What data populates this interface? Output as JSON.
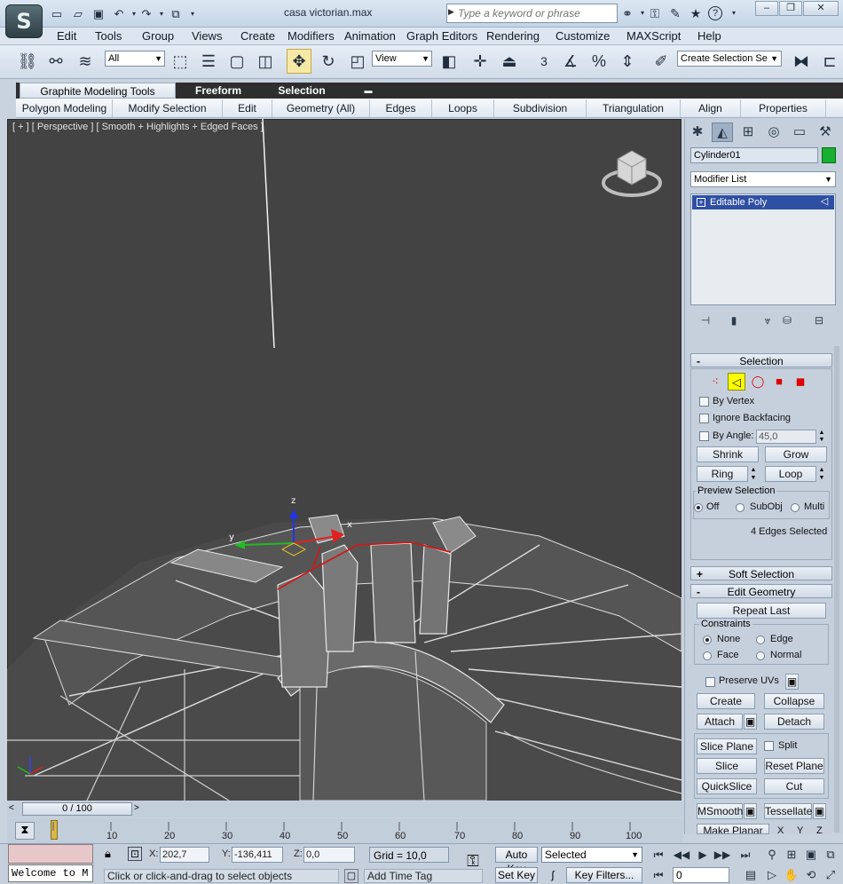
{
  "titlebar": {
    "doc_title": "casa victorian.max",
    "search_placeholder": "Type a keyword or phrase",
    "logo_glyph": "S"
  },
  "menu": [
    "Edit",
    "Tools",
    "Group",
    "Views",
    "Create",
    "Modifiers",
    "Animation",
    "Graph Editors",
    "Rendering",
    "Customize",
    "MAXScript",
    "Help"
  ],
  "toolbar": {
    "selection_filter": "All",
    "reference_coord": "View",
    "angle_snap_label": "3",
    "selection_set_placeholder": "Create Selection Se"
  },
  "ribbon": {
    "tabs": [
      "Graphite Modeling Tools",
      "Freeform",
      "Selection"
    ],
    "panels": [
      "Polygon Modeling",
      "Modify Selection",
      "Edit",
      "Geometry (All)",
      "Edges",
      "Loops",
      "Subdivision",
      "Triangulation",
      "Align",
      "Properties"
    ]
  },
  "viewport": {
    "label": "[ + ] [ Perspective ] [ Smooth + Highlights + Edged Faces ]",
    "gizmo_axes": {
      "x": "x",
      "y": "y",
      "z": "z"
    }
  },
  "command_panel": {
    "object_name": "Cylinder01",
    "object_color": "#17b030",
    "modifier_list": "Modifier List",
    "stack_item": "Editable Poly",
    "selection": {
      "title": "Selection",
      "by_vertex": "By Vertex",
      "ignore_backfacing": "Ignore Backfacing",
      "by_angle": "By Angle:",
      "by_angle_value": "45,0",
      "shrink": "Shrink",
      "grow": "Grow",
      "ring": "Ring",
      "loop": "Loop",
      "preview_selection": "Preview Selection",
      "preview_options": [
        "Off",
        "SubObj",
        "Multi"
      ],
      "status": "4 Edges Selected"
    },
    "soft_selection": "Soft Selection",
    "edit_geometry": {
      "title": "Edit Geometry",
      "repeat_last": "Repeat Last",
      "constraints": "Constraints",
      "constraint_options": [
        "None",
        "Edge",
        "Face",
        "Normal"
      ],
      "preserve_uvs": "Preserve UVs",
      "create": "Create",
      "collapse": "Collapse",
      "attach": "Attach",
      "detach": "Detach",
      "slice_plane": "Slice Plane",
      "split": "Split",
      "slice": "Slice",
      "reset_plane": "Reset Plane",
      "quickslice": "QuickSlice",
      "cut": "Cut",
      "msmooth": "MSmooth",
      "tessellate": "Tessellate",
      "make_planar": "Make Planar",
      "x": "X",
      "y": "Y",
      "z": "Z"
    }
  },
  "timeline": {
    "slider": "0 / 100",
    "ticks": [
      "10",
      "20",
      "30",
      "40",
      "50",
      "60",
      "70",
      "80",
      "90",
      "100"
    ]
  },
  "status": {
    "listener": "Welcome to M",
    "x_label": "X:",
    "x": "202,7",
    "y_label": "Y:",
    "y": "-136,411",
    "z_label": "Z:",
    "z": "0,0",
    "grid": "Grid = 10,0",
    "message": "Click or click-and-drag to select objects",
    "add_time_tag": "Add Time Tag",
    "auto_key": "Auto Key",
    "set_key": "Set Key",
    "key_mode": "Selected",
    "key_filters": "Key Filters...",
    "frame": "0"
  },
  "icons": {
    "help": "?",
    "star": "★",
    "binoculars": "⚭",
    "key": "⚿"
  },
  "colors": {
    "selected_edges": "#d01818",
    "viewport_bg": "#434343",
    "active_subobject": "#ffff00"
  }
}
